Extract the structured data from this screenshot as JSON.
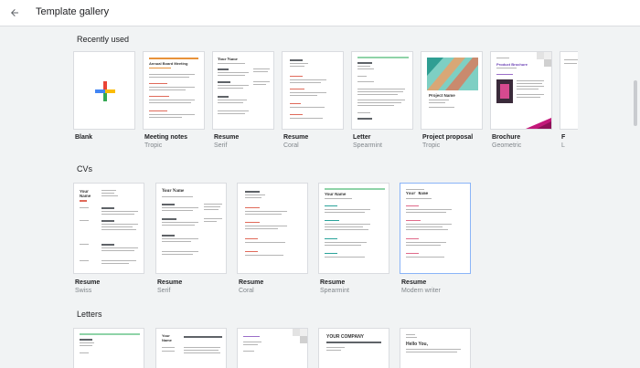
{
  "header": {
    "title": "Template gallery",
    "back_icon": "arrow-back-icon"
  },
  "sections": {
    "recent": {
      "title": "Recently used",
      "items": [
        {
          "name": "Blank",
          "sub": ""
        },
        {
          "name": "Meeting notes",
          "sub": "Tropic"
        },
        {
          "name": "Resume",
          "sub": "Serif"
        },
        {
          "name": "Resume",
          "sub": "Coral"
        },
        {
          "name": "Letter",
          "sub": "Spearmint"
        },
        {
          "name": "Project proposal",
          "sub": "Tropic"
        },
        {
          "name": "Brochure",
          "sub": "Geometric"
        },
        {
          "name": "F",
          "sub": "L"
        }
      ]
    },
    "cvs": {
      "title": "CVs",
      "items": [
        {
          "name": "Resume",
          "sub": "Swiss"
        },
        {
          "name": "Resume",
          "sub": "Serif"
        },
        {
          "name": "Resume",
          "sub": "Coral"
        },
        {
          "name": "Resume",
          "sub": "Spearmint"
        },
        {
          "name": "Resume",
          "sub": "Modern writer"
        }
      ]
    },
    "letters": {
      "title": "Letters",
      "items": [
        {},
        {},
        {},
        {},
        {}
      ]
    }
  },
  "thumb_text": {
    "meeting_title": "Annual Board Meeting",
    "your_name": "Your Name",
    "project_name": "Project Name",
    "product_brochure": "Product Brochure",
    "your_company": "YOUR COMPANY",
    "hello_you": "Hello You,"
  },
  "colors": {
    "accent_blue": "#1a73e8",
    "selected_border": "#8ab4f8",
    "tropic": "#e8923a",
    "spearmint": "#8fd3a8"
  }
}
